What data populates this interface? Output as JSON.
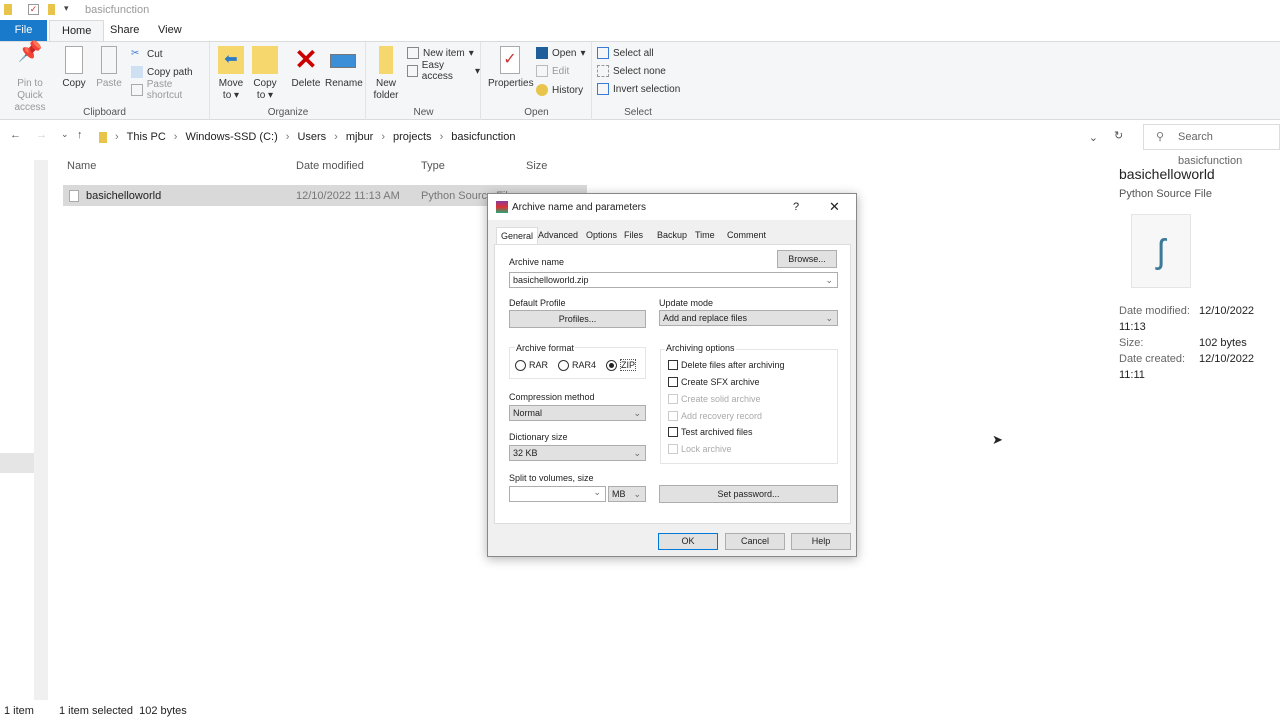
{
  "window": {
    "title": "basicfunction"
  },
  "ribbon_tabs": [
    "File",
    "Home",
    "Share",
    "View"
  ],
  "ribbon": {
    "clipboard": {
      "label": "Clipboard",
      "pin": "Pin to Quick access",
      "copy": "Copy",
      "paste": "Paste",
      "cut": "Cut",
      "copy_path": "Copy path",
      "paste_shortcut": "Paste shortcut"
    },
    "organize": {
      "label": "Organize",
      "move_to": "Move to",
      "copy_to": "Copy to",
      "delete": "Delete",
      "rename": "Rename"
    },
    "new": {
      "label": "New",
      "new_folder": "New folder",
      "new_item": "New item",
      "easy_access": "Easy access"
    },
    "open": {
      "label": "Open",
      "properties": "Properties",
      "open": "Open",
      "edit": "Edit",
      "history": "History"
    },
    "select": {
      "label": "Select",
      "select_all": "Select all",
      "select_none": "Select none",
      "invert": "Invert selection"
    }
  },
  "address": {
    "crumbs": [
      "This PC",
      "Windows-SSD (C:)",
      "Users",
      "mjbur",
      "projects",
      "basicfunction"
    ],
    "search_placeholder": "Search basicfunction"
  },
  "columns": [
    "Name",
    "Date modified",
    "Type",
    "Size"
  ],
  "files": [
    {
      "name": "basichelloworld",
      "modified": "12/10/2022 11:13 AM",
      "type": "Python Source File"
    }
  ],
  "details": {
    "name": "basichelloworld",
    "type": "Python Source File",
    "rows": [
      {
        "k": "Date modified:",
        "v": "12/10/2022 11:13"
      },
      {
        "k": "Size:",
        "v": "102 bytes"
      },
      {
        "k": "Date created:",
        "v": "12/10/2022 11:11"
      }
    ]
  },
  "status": {
    "count": "1 item",
    "selected": "1 item selected  102 bytes"
  },
  "dialog": {
    "title": "Archive name and parameters",
    "help": "?",
    "tabs": [
      "General",
      "Advanced",
      "Options",
      "Files",
      "Backup",
      "Time",
      "Comment"
    ],
    "archive_name_label": "Archive name",
    "archive_name": "basichelloworld.zip",
    "browse": "Browse...",
    "default_profile": "Default Profile",
    "profiles": "Profiles...",
    "update_mode_label": "Update mode",
    "update_mode": "Add and replace files",
    "archive_format": "Archive format",
    "formats": [
      "RAR",
      "RAR4",
      "ZIP"
    ],
    "selected_format": "ZIP",
    "compression_label": "Compression method",
    "compression": "Normal",
    "dict_label": "Dictionary size",
    "dict": "32 KB",
    "split_label": "Split to volumes, size",
    "split_unit": "MB",
    "archiving_options": "Archiving options",
    "options": [
      {
        "label": "Delete files after archiving",
        "enabled": true
      },
      {
        "label": "Create SFX archive",
        "enabled": true
      },
      {
        "label": "Create solid archive",
        "enabled": false
      },
      {
        "label": "Add recovery record",
        "enabled": false
      },
      {
        "label": "Test archived files",
        "enabled": true
      },
      {
        "label": "Lock archive",
        "enabled": false
      }
    ],
    "set_password": "Set password...",
    "ok": "OK",
    "cancel": "Cancel",
    "help_btn": "Help"
  }
}
